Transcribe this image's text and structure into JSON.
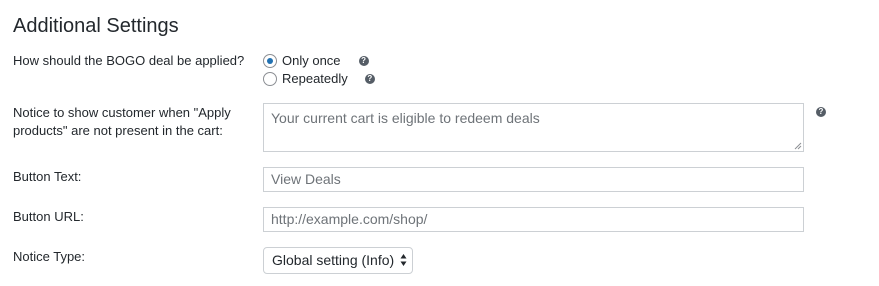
{
  "section": {
    "title": "Additional Settings"
  },
  "bogo": {
    "label": "How should the BOGO deal be applied?",
    "options": [
      {
        "label": "Only once",
        "selected": true
      },
      {
        "label": "Repeatedly",
        "selected": false
      }
    ]
  },
  "notice": {
    "label": "Notice to show customer when \"Apply products\" are not present in the cart:",
    "value": "Your current cart is eligible to redeem deals"
  },
  "button_text": {
    "label": "Button Text:",
    "placeholder": "View Deals"
  },
  "button_url": {
    "label": "Button URL:",
    "placeholder": "http://example.com/shop/"
  },
  "notice_type": {
    "label": "Notice Type:",
    "selected": "Global setting (Info)"
  },
  "colors": {
    "radio_selected": "#2271b1",
    "help_icon": "#555d66",
    "border": "#ccd0d4"
  },
  "icons": {
    "help": "question-mark-icon"
  }
}
